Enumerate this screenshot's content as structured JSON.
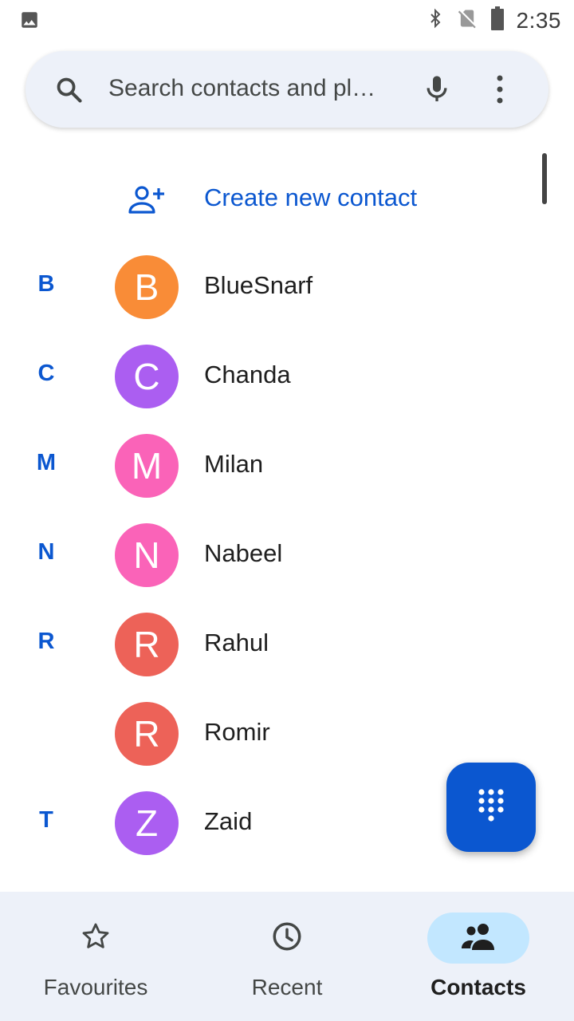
{
  "status_bar": {
    "time": "2:35",
    "icons": [
      "image-icon",
      "bluetooth-icon",
      "no-sim-icon",
      "battery-icon"
    ]
  },
  "search": {
    "placeholder": "Search contacts and pl…",
    "icons": [
      "search-icon",
      "mic-icon",
      "more-vert-icon"
    ]
  },
  "create_contact": {
    "label": "Create new contact",
    "icon": "add-person-icon"
  },
  "contacts": [
    {
      "section": "B",
      "initial": "B",
      "name": "BlueSnarf",
      "color": "#f98c37"
    },
    {
      "section": "C",
      "initial": "C",
      "name": "Chanda",
      "color": "#ab5ef1"
    },
    {
      "section": "M",
      "initial": "M",
      "name": "Milan",
      "color": "#fa63b8"
    },
    {
      "section": "N",
      "initial": "N",
      "name": "Nabeel",
      "color": "#fa63b8"
    },
    {
      "section": "R",
      "initial": "R",
      "name": "Rahul",
      "color": "#ed6258"
    },
    {
      "section": "",
      "initial": "R",
      "name": "Romir",
      "color": "#ed6258"
    },
    {
      "section": "T",
      "initial": "Z",
      "name": "Zaid",
      "color": "#ab5ef1"
    }
  ],
  "fab": {
    "icon": "dialpad-icon"
  },
  "bottom_nav": {
    "items": [
      {
        "label": "Favourites",
        "icon": "star-icon",
        "active": false
      },
      {
        "label": "Recent",
        "icon": "clock-icon",
        "active": false
      },
      {
        "label": "Contacts",
        "icon": "contacts-icon",
        "active": true
      }
    ]
  },
  "colors": {
    "accent": "#0b57d0",
    "search_bg": "#edf1f9",
    "nav_bg": "#edf1f9",
    "nav_active_pill": "#c2e7ff"
  }
}
